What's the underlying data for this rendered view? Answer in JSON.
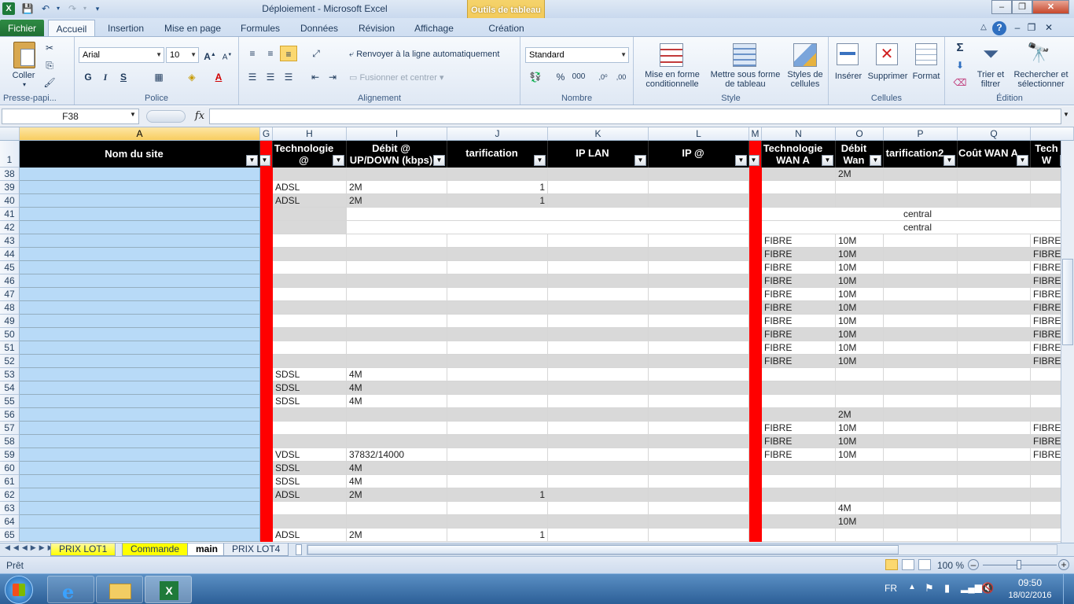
{
  "window": {
    "title": "Déploiement  -  Microsoft Excel",
    "context_tab_group": "Outils de tableau",
    "controls": {
      "minimize": "–",
      "restore": "❐",
      "close": "✕"
    }
  },
  "ribbon_tabs": [
    "Fichier",
    "Accueil",
    "Insertion",
    "Mise en page",
    "Formules",
    "Données",
    "Révision",
    "Affichage",
    "Création"
  ],
  "ribbon": {
    "clipboard": {
      "paste": "Coller",
      "group": "Presse-papi..."
    },
    "font": {
      "name": "Arial",
      "size": "10",
      "group": "Police",
      "bold": "G",
      "italic": "I",
      "underline": "S"
    },
    "alignment": {
      "wrap": "Renvoyer à la ligne automatiquement",
      "merge": "Fusionner et centrer",
      "group": "Alignement"
    },
    "number": {
      "format": "Standard",
      "group": "Nombre",
      "percent": "%",
      "thousands": "000"
    },
    "styles": {
      "cond_format": [
        "Mise en forme",
        "conditionnelle"
      ],
      "format_table": [
        "Mettre sous forme",
        "de tableau"
      ],
      "cell_styles": [
        "Styles de",
        "cellules"
      ],
      "group": "Style"
    },
    "cells": {
      "insert": "Insérer",
      "delete": "Supprimer",
      "format": "Format",
      "group": "Cellules"
    },
    "editing": {
      "sort": [
        "Trier et",
        "filtrer"
      ],
      "find": [
        "Rechercher et",
        "sélectionner"
      ],
      "group": "Édition",
      "sum": "Σ"
    }
  },
  "formula_bar": {
    "name_box": "F38",
    "fx": "fx",
    "content": ""
  },
  "columns": [
    "A",
    "G",
    "H",
    "I",
    "J",
    "K",
    "L",
    "M",
    "N",
    "O",
    "P",
    "Q",
    ""
  ],
  "header_row": {
    "row_number": "1",
    "cells": [
      "Nom du site",
      "",
      "Technologie @",
      "Débit @ UP/DOWN (kbps)",
      "tarification",
      "IP LAN",
      "IP @",
      "?",
      "Technologie WAN A",
      "Débit Wan",
      "tarification2",
      "Coût WAN A",
      "Tech W"
    ]
  },
  "rows": [
    {
      "n": "38",
      "H": "",
      "I": "",
      "J": "",
      "N": "",
      "O": "2M",
      "Z": ""
    },
    {
      "n": "39",
      "H": "ADSL",
      "I": "2M",
      "J": "1",
      "N": "",
      "O": "",
      "Z": ""
    },
    {
      "n": "40",
      "H": "ADSL",
      "I": "2M",
      "J": "1",
      "N": "",
      "O": "",
      "Z": ""
    },
    {
      "n": "41",
      "merged": "central"
    },
    {
      "n": "42",
      "merged": "central"
    },
    {
      "n": "43",
      "H": "",
      "I": "",
      "J": "",
      "N": "FIBRE",
      "O": "10M",
      "Z": "FIBRE"
    },
    {
      "n": "44",
      "H": "",
      "I": "",
      "J": "",
      "N": "FIBRE",
      "O": "10M",
      "Z": "FIBRE"
    },
    {
      "n": "45",
      "H": "",
      "I": "",
      "J": "",
      "N": "FIBRE",
      "O": "10M",
      "Z": "FIBRE"
    },
    {
      "n": "46",
      "H": "",
      "I": "",
      "J": "",
      "N": "FIBRE",
      "O": "10M",
      "Z": "FIBRE"
    },
    {
      "n": "47",
      "H": "",
      "I": "",
      "J": "",
      "N": "FIBRE",
      "O": "10M",
      "Z": "FIBRE"
    },
    {
      "n": "48",
      "H": "",
      "I": "",
      "J": "",
      "N": "FIBRE",
      "O": "10M",
      "Z": "FIBRE"
    },
    {
      "n": "49",
      "H": "",
      "I": "",
      "J": "",
      "N": "FIBRE",
      "O": "10M",
      "Z": "FIBRE"
    },
    {
      "n": "50",
      "H": "",
      "I": "",
      "J": "",
      "N": "FIBRE",
      "O": "10M",
      "Z": "FIBRE"
    },
    {
      "n": "51",
      "H": "",
      "I": "",
      "J": "",
      "N": "FIBRE",
      "O": "10M",
      "Z": "FIBRE"
    },
    {
      "n": "52",
      "H": "",
      "I": "",
      "J": "",
      "N": "FIBRE",
      "O": "10M",
      "Z": "FIBRE"
    },
    {
      "n": "53",
      "H": "SDSL",
      "I": "4M",
      "J": "",
      "N": "",
      "O": "",
      "Z": ""
    },
    {
      "n": "54",
      "H": "SDSL",
      "I": "4M",
      "J": "",
      "N": "",
      "O": "",
      "Z": ""
    },
    {
      "n": "55",
      "H": "SDSL",
      "I": "4M",
      "J": "",
      "N": "",
      "O": "",
      "Z": ""
    },
    {
      "n": "56",
      "H": "",
      "I": "",
      "J": "",
      "N": "",
      "O": "2M",
      "Z": ""
    },
    {
      "n": "57",
      "H": "",
      "I": "",
      "J": "",
      "N": "FIBRE",
      "O": "10M",
      "Z": "FIBRE"
    },
    {
      "n": "58",
      "H": "",
      "I": "",
      "J": "",
      "N": "FIBRE",
      "O": "10M",
      "Z": "FIBRE"
    },
    {
      "n": "59",
      "H": "VDSL",
      "I": "37832/14000",
      "J": "",
      "N": "FIBRE",
      "O": "10M",
      "Z": "FIBRE"
    },
    {
      "n": "60",
      "H": "SDSL",
      "I": "4M",
      "J": "",
      "N": "",
      "O": "",
      "Z": ""
    },
    {
      "n": "61",
      "H": "SDSL",
      "I": "4M",
      "J": "",
      "N": "",
      "O": "",
      "Z": ""
    },
    {
      "n": "62",
      "H": "ADSL",
      "I": "2M",
      "J": "1",
      "N": "",
      "O": "",
      "Z": ""
    },
    {
      "n": "63",
      "H": "",
      "I": "",
      "J": "",
      "N": "",
      "O": "4M",
      "Z": ""
    },
    {
      "n": "64",
      "H": "",
      "I": "",
      "J": "",
      "N": "",
      "O": "10M",
      "Z": ""
    },
    {
      "n": "65",
      "H": "ADSL",
      "I": "2M",
      "J": "1",
      "N": "",
      "O": "",
      "Z": ""
    }
  ],
  "sheet_tabs": [
    "PRIX LOT1",
    "Commande",
    "main",
    "PRIX LOT4"
  ],
  "sheet_tab_colors": {
    "PRIX LOT1": "#ffff00",
    "Commande": "#ffff00"
  },
  "status": {
    "ready": "Prêt",
    "zoom": "100 %"
  },
  "taskbar": {
    "lang": "FR",
    "time": "09:50",
    "date": "18/02/2016"
  },
  "colors": {
    "header_bg": "#000000",
    "red_column": "#ff0000",
    "site_column": "#b8daf7",
    "alt_row": "#d9d9d9",
    "excel_green": "#1f6e33"
  }
}
